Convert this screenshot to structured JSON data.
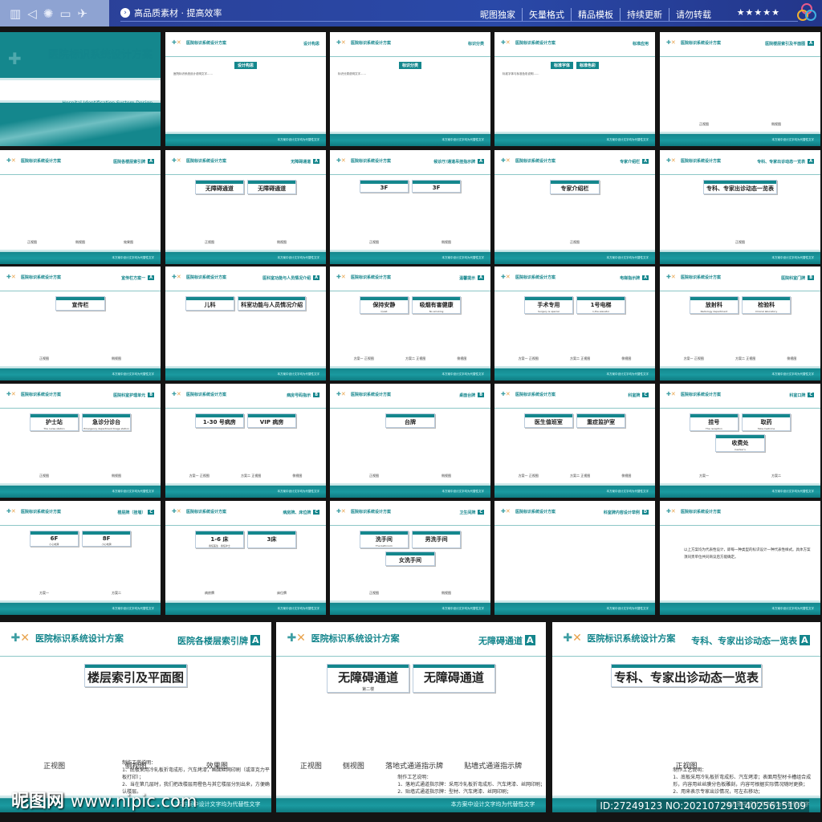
{
  "topbar": {
    "slogan": "高品质素材 · 提高效率",
    "nav": [
      "昵图独家",
      "矢量格式",
      "精品模板",
      "持续更新",
      "请勿转载"
    ],
    "stars": "★★★★★",
    "icons": [
      "books-icon",
      "megaphone-icon",
      "atom-icon",
      "monitor-icon",
      "rocket-icon"
    ]
  },
  "brand": {
    "title": "医院标识系统设计方案",
    "subtitle": "Hospital Identification System Design",
    "footer": "本方案中设计文字均为代替性文字"
  },
  "colors": {
    "teal": "#14878d",
    "accent": "#e8a24b",
    "topbar": "#2a49a8"
  },
  "slides": [
    {
      "type": "cover"
    },
    {
      "section": "设计构思",
      "headings": [
        "设计构思"
      ],
      "para": "医院标识系统设计说明文字……"
    },
    {
      "section": "标识分类",
      "headings": [
        "标识分类"
      ],
      "para": "标识分类说明文字……"
    },
    {
      "section": "标准应用",
      "headings": [
        "标准字体",
        "标准色彩"
      ],
      "para": "标准字体与标准色彩说明……"
    },
    {
      "section": "医院楼层索引及平面图",
      "badge": "A",
      "caps": [
        "正视图",
        "侧视图"
      ]
    },
    {
      "section": "医院各楼层索引牌",
      "badge": "A",
      "caps": [
        "正视图",
        "侧视图",
        "效果图"
      ]
    },
    {
      "section": "无障碍通道",
      "badge": "A",
      "signs": [
        {
          "t": "无障碍通道"
        },
        {
          "t": "无障碍通道"
        }
      ],
      "caps": [
        "正视图",
        "侧视图"
      ]
    },
    {
      "section": "候诊厅/通道吊挂指示牌",
      "badge": "A",
      "signs": [
        {
          "t": "3F"
        },
        {
          "t": "3F"
        }
      ],
      "caps": [
        "正视图",
        "侧视图"
      ]
    },
    {
      "section": "专家介绍栏",
      "badge": "A",
      "signs": [
        {
          "t": "专家介绍栏"
        }
      ],
      "caps": [
        "正视图"
      ]
    },
    {
      "section": "专科、专家出诊动态一览表",
      "badge": "A",
      "signs": [
        {
          "t": "专科、专家出诊动态一览表"
        }
      ],
      "caps": [
        "正视图"
      ]
    },
    {
      "section": "宣传栏方案一",
      "badge": "A",
      "signs": [
        {
          "t": "宣传栏"
        }
      ],
      "caps": [
        "正视图",
        "侧视图"
      ]
    },
    {
      "section": "医科室功能与人员情况介绍",
      "badge": "A",
      "signs": [
        {
          "t": "儿科"
        },
        {
          "t": "科室功能与人员情况介绍"
        }
      ],
      "caps": []
    },
    {
      "section": "温馨提示",
      "badge": "A",
      "signs": [
        {
          "t": "保持安静",
          "e": "Quiet"
        },
        {
          "t": "吸烟有害健康",
          "e": "No smoking"
        }
      ],
      "caps": [
        "方案一 正视图",
        "方案二 正视图",
        "侧视图"
      ]
    },
    {
      "section": "电梯指示牌",
      "badge": "A",
      "signs": [
        {
          "t": "手术专用",
          "e": "Surgery is special"
        },
        {
          "t": "1号电梯",
          "e": "1,the elevator"
        }
      ],
      "caps": [
        "方案一 正视图",
        "方案二 正视图",
        "侧视图"
      ]
    },
    {
      "section": "医院科室门牌",
      "badge": "B",
      "signs": [
        {
          "t": "放射科",
          "e": "Radiology department"
        },
        {
          "t": "检验科",
          "e": "Clinical laboratory"
        }
      ],
      "caps": [
        "方案一 正视图",
        "方案二 正视图",
        "侧视图"
      ]
    },
    {
      "section": "医院科室护理单元",
      "badge": "B",
      "signs": [
        {
          "t": "护士站",
          "e": "The nurse station"
        },
        {
          "t": "急诊分诊台",
          "e": "Emergency department triage station"
        }
      ],
      "caps": [
        "正视图",
        "侧视图"
      ]
    },
    {
      "section": "病房号码指示",
      "badge": "B",
      "signs": [
        {
          "t": "1-30 号病房"
        },
        {
          "t": "VIP 病房"
        }
      ],
      "caps": [
        "方案一 正视图",
        "方案二 正视图",
        "侧视图"
      ]
    },
    {
      "section": "桌面台牌",
      "badge": "B",
      "signs": [
        {
          "t": "台牌"
        }
      ],
      "caps": [
        "正视图",
        "侧视图"
      ]
    },
    {
      "section": "科室牌",
      "badge": "C",
      "signs": [
        {
          "t": "医生值班室"
        },
        {
          "t": "重症监护室"
        }
      ],
      "caps": [
        "方案一 正视图",
        "方案二 正视图",
        "侧视图"
      ]
    },
    {
      "section": "科室口牌",
      "badge": "C",
      "signs": [
        {
          "t": "挂号",
          "e": "The reception"
        },
        {
          "t": "取药",
          "e": "Take medicine"
        },
        {
          "t": "收费处",
          "e": "Cashier's"
        }
      ],
      "caps": [
        "方案一",
        "方案二"
      ]
    },
    {
      "section": "楼层牌（挂墙）",
      "badge": "C",
      "signs": [
        {
          "t": "6F",
          "e": "小心地滑"
        },
        {
          "t": "8F",
          "e": "小心地滑"
        }
      ],
      "caps": [
        "方案一",
        "方案二"
      ]
    },
    {
      "section": "病房牌、床位牌",
      "badge": "C",
      "signs": [
        {
          "t": "1-6 床",
          "e": "责任医生 · 责任护士"
        },
        {
          "t": "3床"
        }
      ],
      "caps": [
        "病房牌",
        "床位牌"
      ]
    },
    {
      "section": "卫生间牌",
      "badge": "C",
      "signs": [
        {
          "t": "洗手间",
          "e": "The bathroom"
        },
        {
          "t": "男洗手间"
        },
        {
          "t": "女洗手间"
        }
      ],
      "caps": [
        "正视图",
        "侧视图"
      ]
    },
    {
      "section": "科室牌内容设计举例",
      "badge": "D",
      "caps": []
    },
    {
      "type": "closing",
      "text": "以上方案均为代表性设计，即每一种类型的标识设计一种代表性样式。具体方案须同贵单位共同商议后方能确定。"
    }
  ],
  "big_slides": [
    {
      "section": "医院各楼层索引牌",
      "badge": "A",
      "signs": [
        {
          "t": "楼层索引及平面图"
        }
      ],
      "caps": [
        "正视图",
        "侧视图",
        "效果图"
      ],
      "notes": [
        "制作工艺说明：",
        "1、底板采用冷轧板折弯成形，汽车烤漆，画面丝网印刷（或亚克力平板打印）；",
        "2、当在第几层时，我们把改楼层用橙色与其它楼层分别出来，方便确认楼层。"
      ]
    },
    {
      "section": "无障碍通道",
      "badge": "A",
      "signs": [
        {
          "t": "无障碍通道",
          "e": "第二楼"
        },
        {
          "t": "无障碍通道"
        }
      ],
      "caps": [
        "正视图",
        "侧视图",
        "落地式通道指示牌",
        "贴墙式通道指示牌"
      ],
      "notes": [
        "制作工艺说明：",
        "1、落地式通道指示牌：采用冷轧板折弯成形、汽车烤漆、丝网印刷；",
        "2、贴墙式通道指示牌：型材、汽车烤漆、丝网印刷；"
      ]
    },
    {
      "section": "专科、专家出诊动态一览表",
      "badge": "A",
      "signs": [
        {
          "t": "专科、专家出诊动态一览表"
        }
      ],
      "caps": [
        "正视图"
      ],
      "notes": [
        "制作工艺说明：",
        "1、底板采用冷轧板折弯成形、汽车烤漆；表面用型材卡槽组合成形，内容用丝丝膜分色板雕刻，内容可根据实际情况随时更换；",
        "2、用来表示专家出诊情况，可左右移动；"
      ]
    }
  ],
  "watermark": {
    "site_cn": "昵图网",
    "site_url": "www.nipic.com",
    "id": "ID:27249123 NO:20210729114025615109"
  }
}
